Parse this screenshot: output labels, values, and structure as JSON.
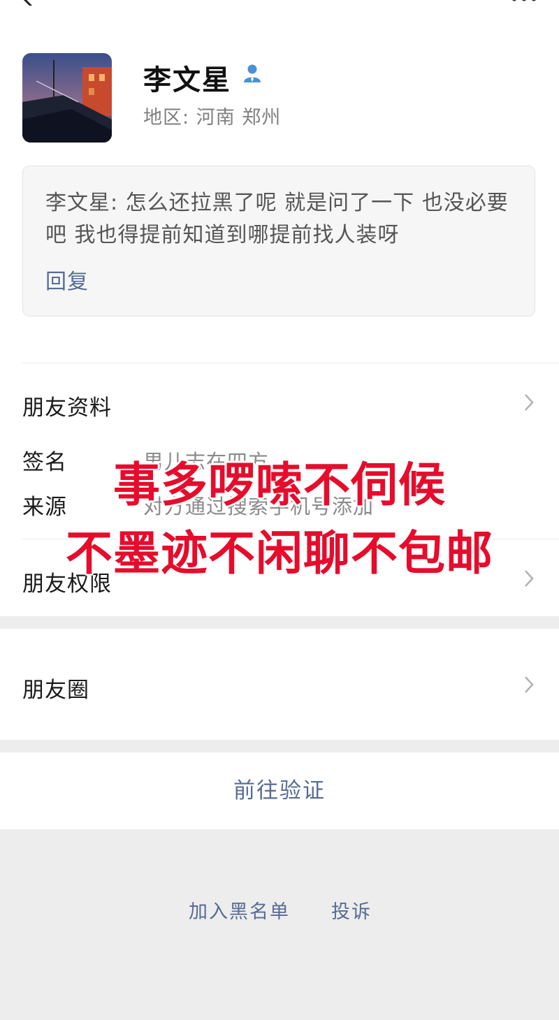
{
  "profile": {
    "name": "李文星",
    "region": "地区:  河南  郑州"
  },
  "message": {
    "text": "李文星: 怎么还拉黑了呢 就是问了一下 也没必要吧 我也得提前知道到哪提前找人装呀",
    "reply_label": "回复"
  },
  "rows": {
    "friend_profile": "朋友资料",
    "signature_label": "签名",
    "signature_value": "男儿志在四方",
    "source_label": "来源",
    "source_value": "对方通过搜索手机号添加",
    "friend_permissions": "朋友权限",
    "moments": "朋友圈"
  },
  "actions": {
    "verify": "前往验证",
    "blacklist": "加入黑名单",
    "complain": "投诉"
  },
  "overlay": {
    "line1": "事多啰嗦不伺候",
    "line2": "不墨迹不闲聊不包邮"
  },
  "colors": {
    "link": "#576b95",
    "overlay_red": "#e60c2c",
    "gap": "#ededed"
  },
  "icons": [
    "back-icon",
    "more-icon",
    "verified-person-icon",
    "chevron-right-icon"
  ]
}
